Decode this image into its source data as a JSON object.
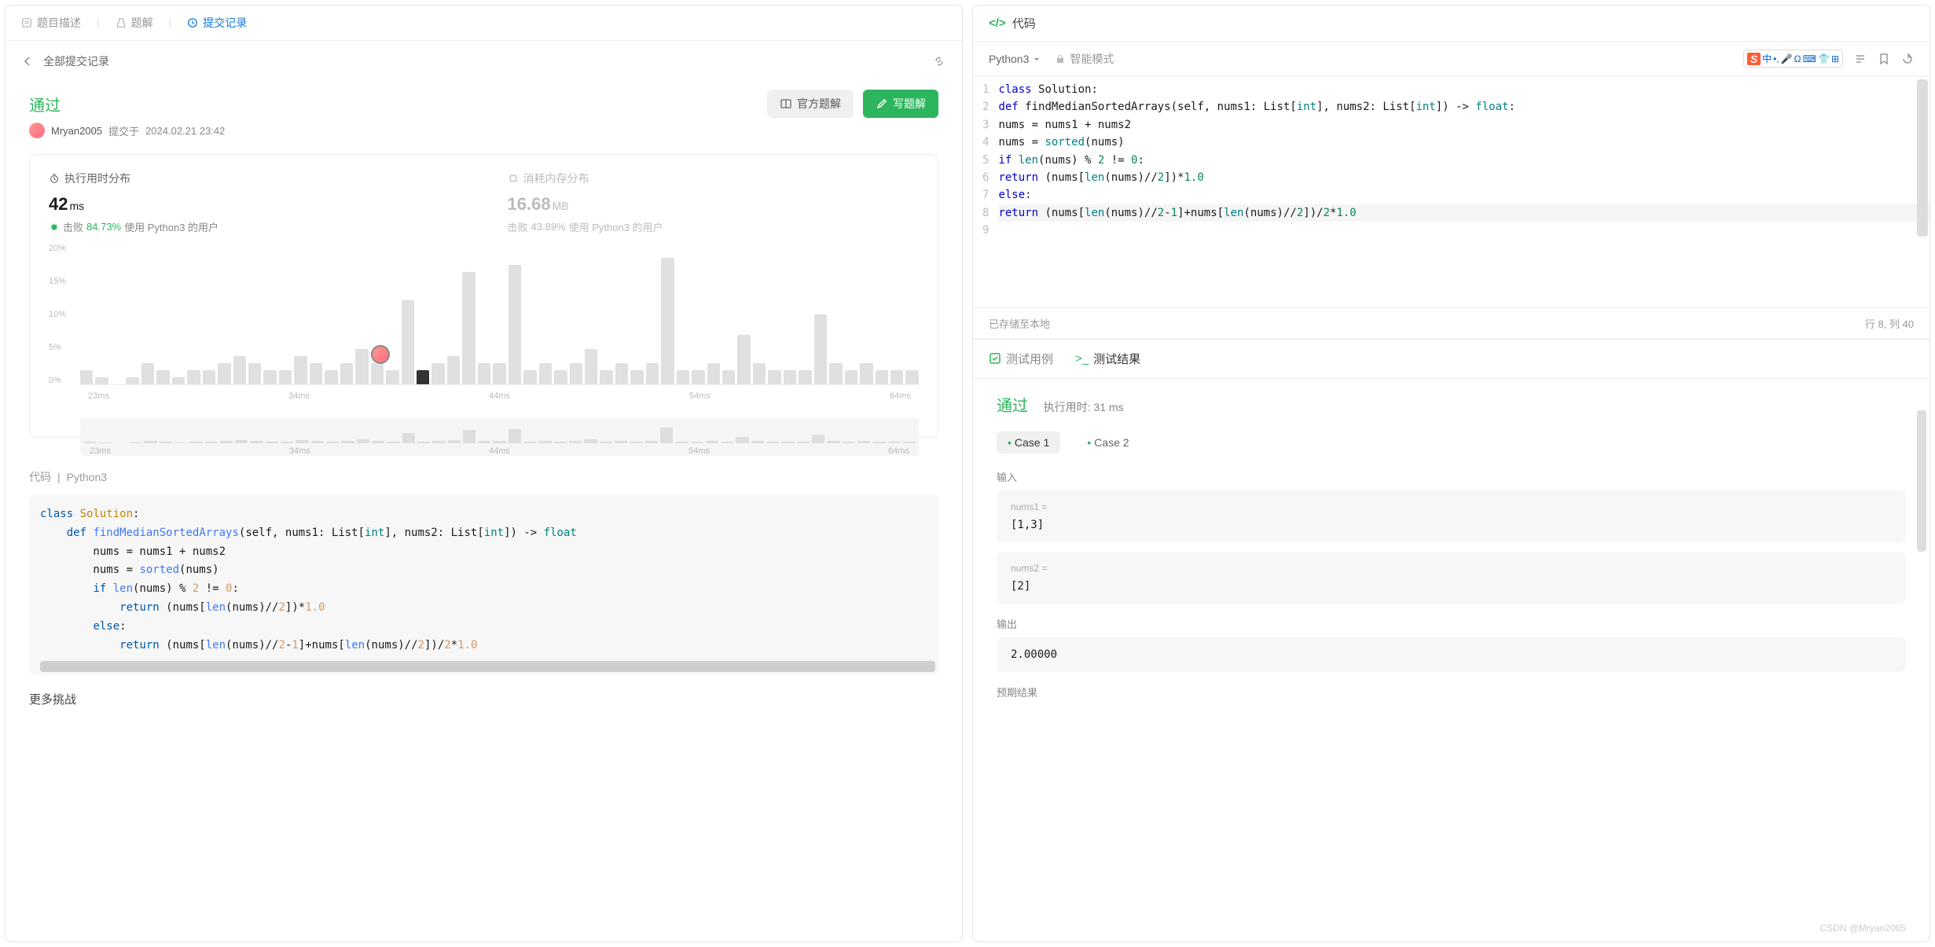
{
  "left": {
    "tabs": [
      "题目描述",
      "题解",
      "提交记录"
    ],
    "active_tab": 2,
    "back_label": "全部提交记录",
    "status": "通过",
    "btn_official": "官方题解",
    "btn_write": "写题解",
    "user": "Mryan2005",
    "submit_prefix": "提交于",
    "submit_time": "2024.02.21 23:42",
    "runtime_title": "执行用时分布",
    "runtime_value": "42",
    "runtime_unit": "ms",
    "runtime_beat_prefix": "击败",
    "runtime_beat": "84.73%",
    "runtime_beat_suffix": "使用 Python3 的用户",
    "memory_title": "消耗内存分布",
    "memory_value": "16.68",
    "memory_unit": "MB",
    "memory_beat_prefix": "击败",
    "memory_beat": "43.89%",
    "memory_beat_suffix": "使用 Python3 的用户",
    "y_labels": [
      "20%",
      "15%",
      "10%",
      "5%",
      "0%"
    ],
    "x_labels": [
      "23ms",
      "34ms",
      "44ms",
      "54ms",
      "64ms"
    ],
    "code_label": "代码",
    "code_lang": "Python3",
    "more": "更多挑战"
  },
  "right": {
    "header": "代码",
    "lang": "Python3",
    "mode": "智能模式",
    "ime": "中",
    "saved": "已存储至本地",
    "cursor": "行 8,  列 40",
    "tabs_bottom": [
      "测试用例",
      "测试结果"
    ],
    "active_bottom": 1,
    "pass": "通过",
    "runtime": "执行用时: 31 ms",
    "cases": [
      "Case 1",
      "Case 2"
    ],
    "active_case": 0,
    "input_label": "输入",
    "nums1_label": "nums1 =",
    "nums1_val": "[1,3]",
    "nums2_label": "nums2 =",
    "nums2_val": "[2]",
    "output_label": "输出",
    "output_val": "2.00000",
    "expected_label": "预期结果",
    "watermark": "CSDN @Mryan2005"
  },
  "chart_data": {
    "type": "bar",
    "title": "执行用时分布",
    "xlabel": "ms",
    "ylabel": "%",
    "ylim": [
      0,
      20
    ],
    "x_ticks": [
      "23ms",
      "34ms",
      "44ms",
      "54ms",
      "64ms"
    ],
    "bars": [
      2,
      1,
      0,
      1,
      3,
      2,
      1,
      2,
      2,
      3,
      4,
      3,
      2,
      2,
      4,
      3,
      2,
      3,
      5,
      3,
      2,
      12,
      2,
      3,
      4,
      16,
      3,
      3,
      17,
      2,
      3,
      2,
      3,
      5,
      2,
      3,
      2,
      3,
      18,
      2,
      2,
      3,
      2,
      7,
      3,
      2,
      2,
      2,
      10,
      3,
      2,
      3,
      2,
      2,
      2
    ],
    "highlight_index": 22,
    "marker_position": 22
  },
  "code": {
    "lines": [
      "class Solution:",
      "    def findMedianSortedArrays(self, nums1: List[int], nums2: List[int]) -> float:",
      "        nums = nums1 + nums2",
      "        nums = sorted(nums)",
      "        if len(nums) % 2 != 0:",
      "            return (nums[len(nums)//2])*1.0",
      "        else:",
      "            return (nums[len(nums)//2-1]+nums[len(nums)//2])/2*1.0"
    ]
  }
}
